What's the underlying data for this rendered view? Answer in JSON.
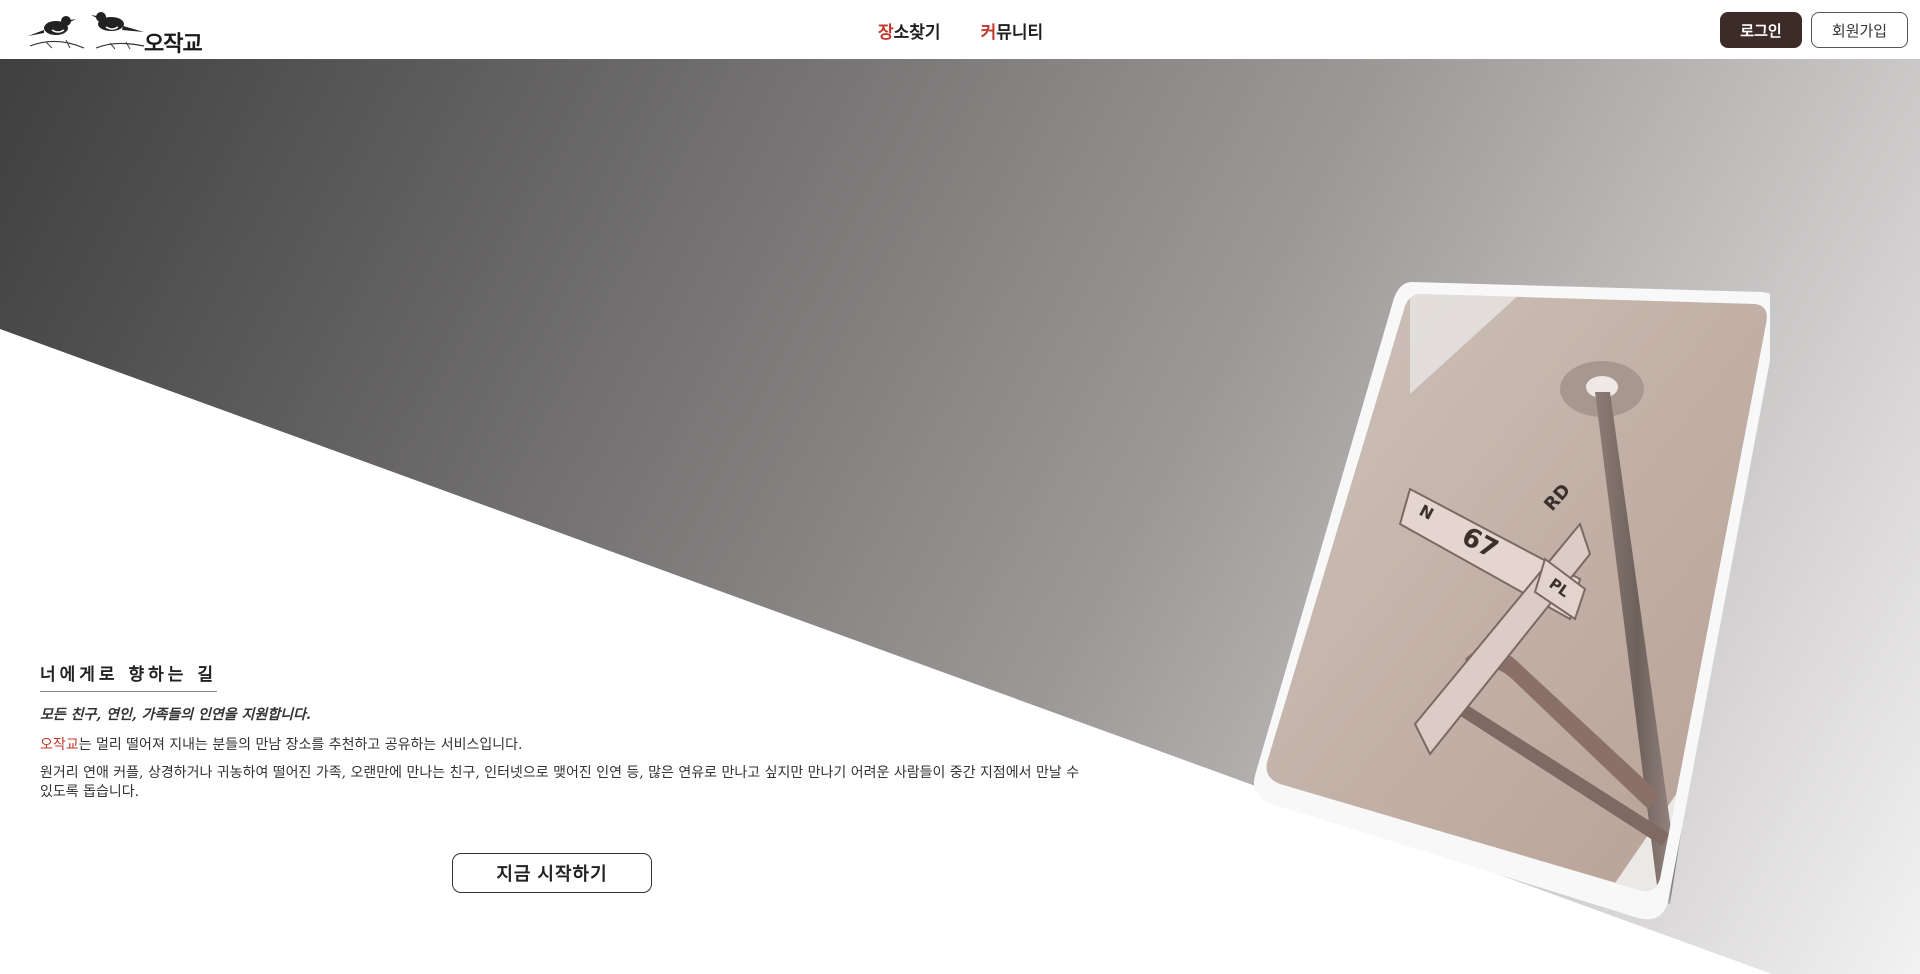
{
  "header": {
    "logo_text": "오작교",
    "nav": [
      {
        "accent": "장",
        "rest": "소찾기"
      },
      {
        "accent": "커",
        "rest": "뮤니티"
      }
    ],
    "login_label": "로그인",
    "signup_label": "회원가입"
  },
  "hero": {
    "sign_texts": [
      "N",
      "67",
      "RD",
      "PL"
    ]
  },
  "intro": {
    "title": "너에게로 향하는 길",
    "subtitle": "모든 친구, 연인, 가족들의 인연을 지원합니다.",
    "p1_brand": "오작교",
    "p1_rest": "는 멀리 떨어져 지내는 분들의 만남 장소를 추천하고 공유하는 서비스입니다.",
    "p2": "원거리 연애 커플, 상경하거나 귀농하여 떨어진 가족, 오랜만에 만나는 친구, 인터넷으로 맺어진 인연 등, 많은 연유로 만나고 싶지만 만나기 어려운 사람들이 중간 지점에서 만날 수 있도록 돕습니다.",
    "cta_label": "지금 시작하기"
  },
  "colors": {
    "accent": "#c0392b",
    "login_bg": "#3d2b27"
  }
}
